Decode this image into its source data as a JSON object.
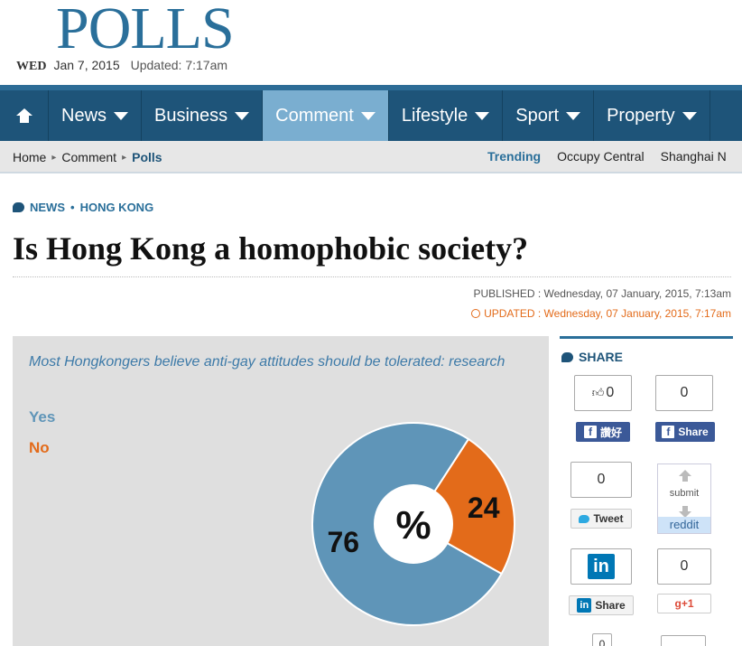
{
  "masthead": {
    "title": "POLLS",
    "day": "WED",
    "date": "Jan 7, 2015",
    "updated": "Updated: 7:17am"
  },
  "nav": {
    "items": [
      {
        "label": "News"
      },
      {
        "label": "Business"
      },
      {
        "label": "Comment"
      },
      {
        "label": "Lifestyle"
      },
      {
        "label": "Sport"
      },
      {
        "label": "Property"
      }
    ],
    "active_color": "#7aaed0",
    "bar_color": "#1e5479"
  },
  "breadcrumb": {
    "items": [
      "Home",
      "Comment",
      "Polls"
    ],
    "separator": "▸"
  },
  "trending": {
    "label": "Trending",
    "items": [
      "Occupy Central",
      "Shanghai N"
    ]
  },
  "article": {
    "section": "NEWS",
    "subsection": "HONG KONG",
    "section_separator": "•",
    "headline": "Is Hong Kong a homophobic society?",
    "published": "PUBLISHED : Wednesday, 07 January, 2015, 7:13am",
    "updated": "UPDATED : Wednesday, 07 January, 2015, 7:17am"
  },
  "poll": {
    "caption": "Most Hongkongers believe anti-gay attitudes should be tolerated: research",
    "legend_yes": "Yes",
    "legend_no": "No",
    "center_label": "%"
  },
  "chart_data": {
    "type": "pie",
    "categories": [
      "Yes",
      "No"
    ],
    "values": [
      76,
      24
    ],
    "colors": [
      "#5f95b8",
      "#e36b1a"
    ],
    "title": "",
    "legend_position": "top-left"
  },
  "share": {
    "title": "SHARE",
    "like_count": "0",
    "like_label": "讚好",
    "fb_share_count": "0",
    "fb_share_label": "Share",
    "tweet_count": "0",
    "tweet_label": "Tweet",
    "reddit_submit": "submit",
    "reddit_label": "reddit",
    "linkedin_label": "Share",
    "linkedin_logo": "in",
    "gplus_count": "0",
    "gplus_label": "g+1",
    "extra_count": "0"
  }
}
